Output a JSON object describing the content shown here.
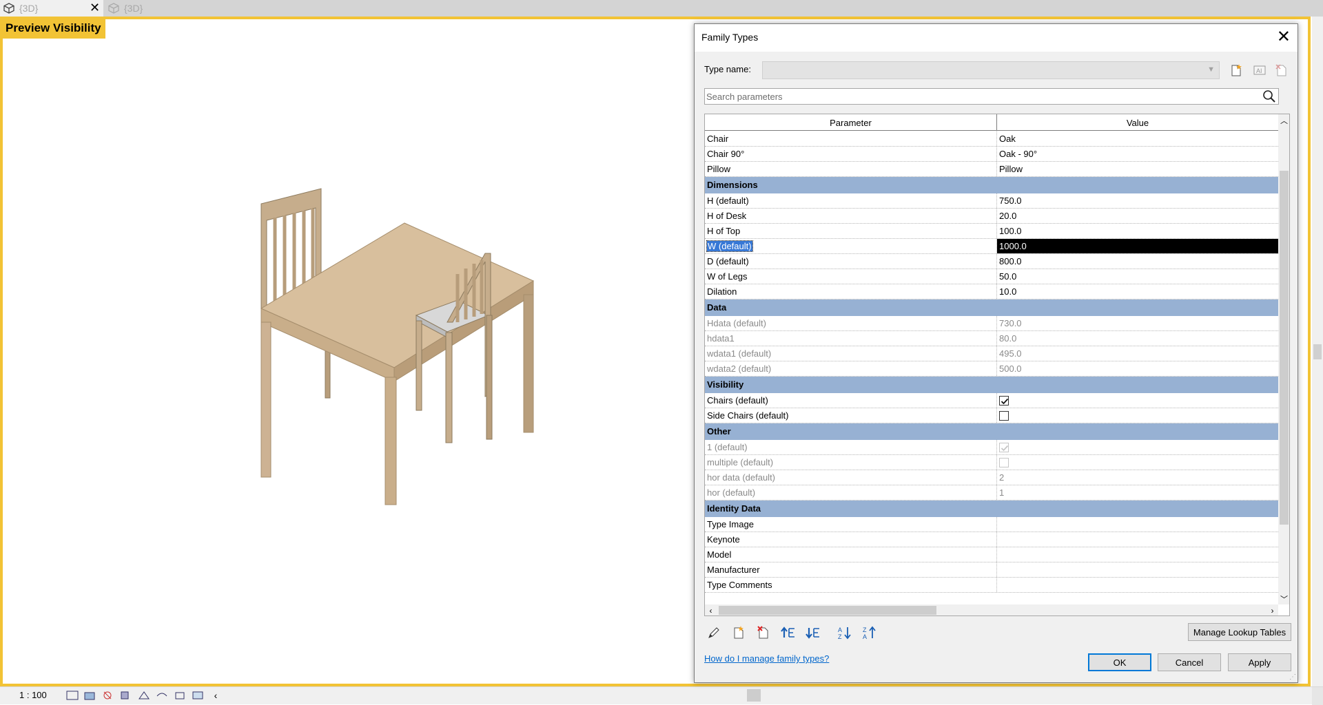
{
  "tabs": [
    {
      "label": "{3D}",
      "active": true
    },
    {
      "label": "{3D}",
      "active": false
    }
  ],
  "viewport": {
    "label": "Preview Visibility",
    "frame_color": "#f2c335"
  },
  "status": {
    "scale": "1 : 100"
  },
  "dialog": {
    "title": "Family Types",
    "type_name_label": "Type name:",
    "type_name_value": "",
    "search_placeholder": "Search parameters",
    "columns": [
      "Parameter",
      "Value"
    ],
    "rows": [
      {
        "kind": "param",
        "param": "Chair",
        "value": "Oak"
      },
      {
        "kind": "param",
        "param": "Chair 90°",
        "value": "Oak - 90°"
      },
      {
        "kind": "param",
        "param": "Pillow",
        "value": "Pillow"
      },
      {
        "kind": "group",
        "param": "Dimensions"
      },
      {
        "kind": "param",
        "param": "H (default)",
        "value": "750.0"
      },
      {
        "kind": "param",
        "param": "H of Desk",
        "value": "20.0"
      },
      {
        "kind": "param",
        "param": "H of Top",
        "value": "100.0"
      },
      {
        "kind": "param",
        "param": "W (default)",
        "value": "1000.0",
        "selected": true
      },
      {
        "kind": "param",
        "param": "D (default)",
        "value": "800.0"
      },
      {
        "kind": "param",
        "param": "W of Legs",
        "value": "50.0"
      },
      {
        "kind": "param",
        "param": "Dilation",
        "value": "10.0"
      },
      {
        "kind": "group",
        "param": "Data"
      },
      {
        "kind": "param",
        "param": "Hdata (default)",
        "value": "730.0",
        "disabled": true
      },
      {
        "kind": "param",
        "param": "hdata1",
        "value": "80.0",
        "disabled": true
      },
      {
        "kind": "param",
        "param": "wdata1 (default)",
        "value": "495.0",
        "disabled": true
      },
      {
        "kind": "param",
        "param": "wdata2 (default)",
        "value": "500.0",
        "disabled": true
      },
      {
        "kind": "group",
        "param": "Visibility"
      },
      {
        "kind": "check",
        "param": "Chairs (default)",
        "checked": true
      },
      {
        "kind": "check",
        "param": "Side Chairs (default)",
        "checked": false
      },
      {
        "kind": "group",
        "param": "Other"
      },
      {
        "kind": "check",
        "param": "1 (default)",
        "checked": true,
        "disabled": true
      },
      {
        "kind": "check",
        "param": "multiple (default)",
        "checked": false,
        "disabled": true
      },
      {
        "kind": "param",
        "param": "hor data (default)",
        "value": "2",
        "disabled": true
      },
      {
        "kind": "param",
        "param": "hor (default)",
        "value": "1",
        "disabled": true
      },
      {
        "kind": "group",
        "param": "Identity Data"
      },
      {
        "kind": "param",
        "param": "Type Image",
        "value": ""
      },
      {
        "kind": "param",
        "param": "Keynote",
        "value": ""
      },
      {
        "kind": "param",
        "param": "Model",
        "value": ""
      },
      {
        "kind": "param",
        "param": "Manufacturer",
        "value": ""
      },
      {
        "kind": "param",
        "param": "Type Comments",
        "value": ""
      }
    ],
    "tools": [
      "pencil-icon",
      "new-parameter-icon",
      "delete-parameter-icon",
      "move-up-icon",
      "move-down-icon",
      "sort-ascending-icon",
      "sort-descending-icon"
    ],
    "manage_lookup_label": "Manage Lookup Tables",
    "help_link": "How do I manage family types?",
    "ok_label": "OK",
    "cancel_label": "Cancel",
    "apply_label": "Apply",
    "group_color": "#97b1d3",
    "link_color": "#0066cc"
  }
}
